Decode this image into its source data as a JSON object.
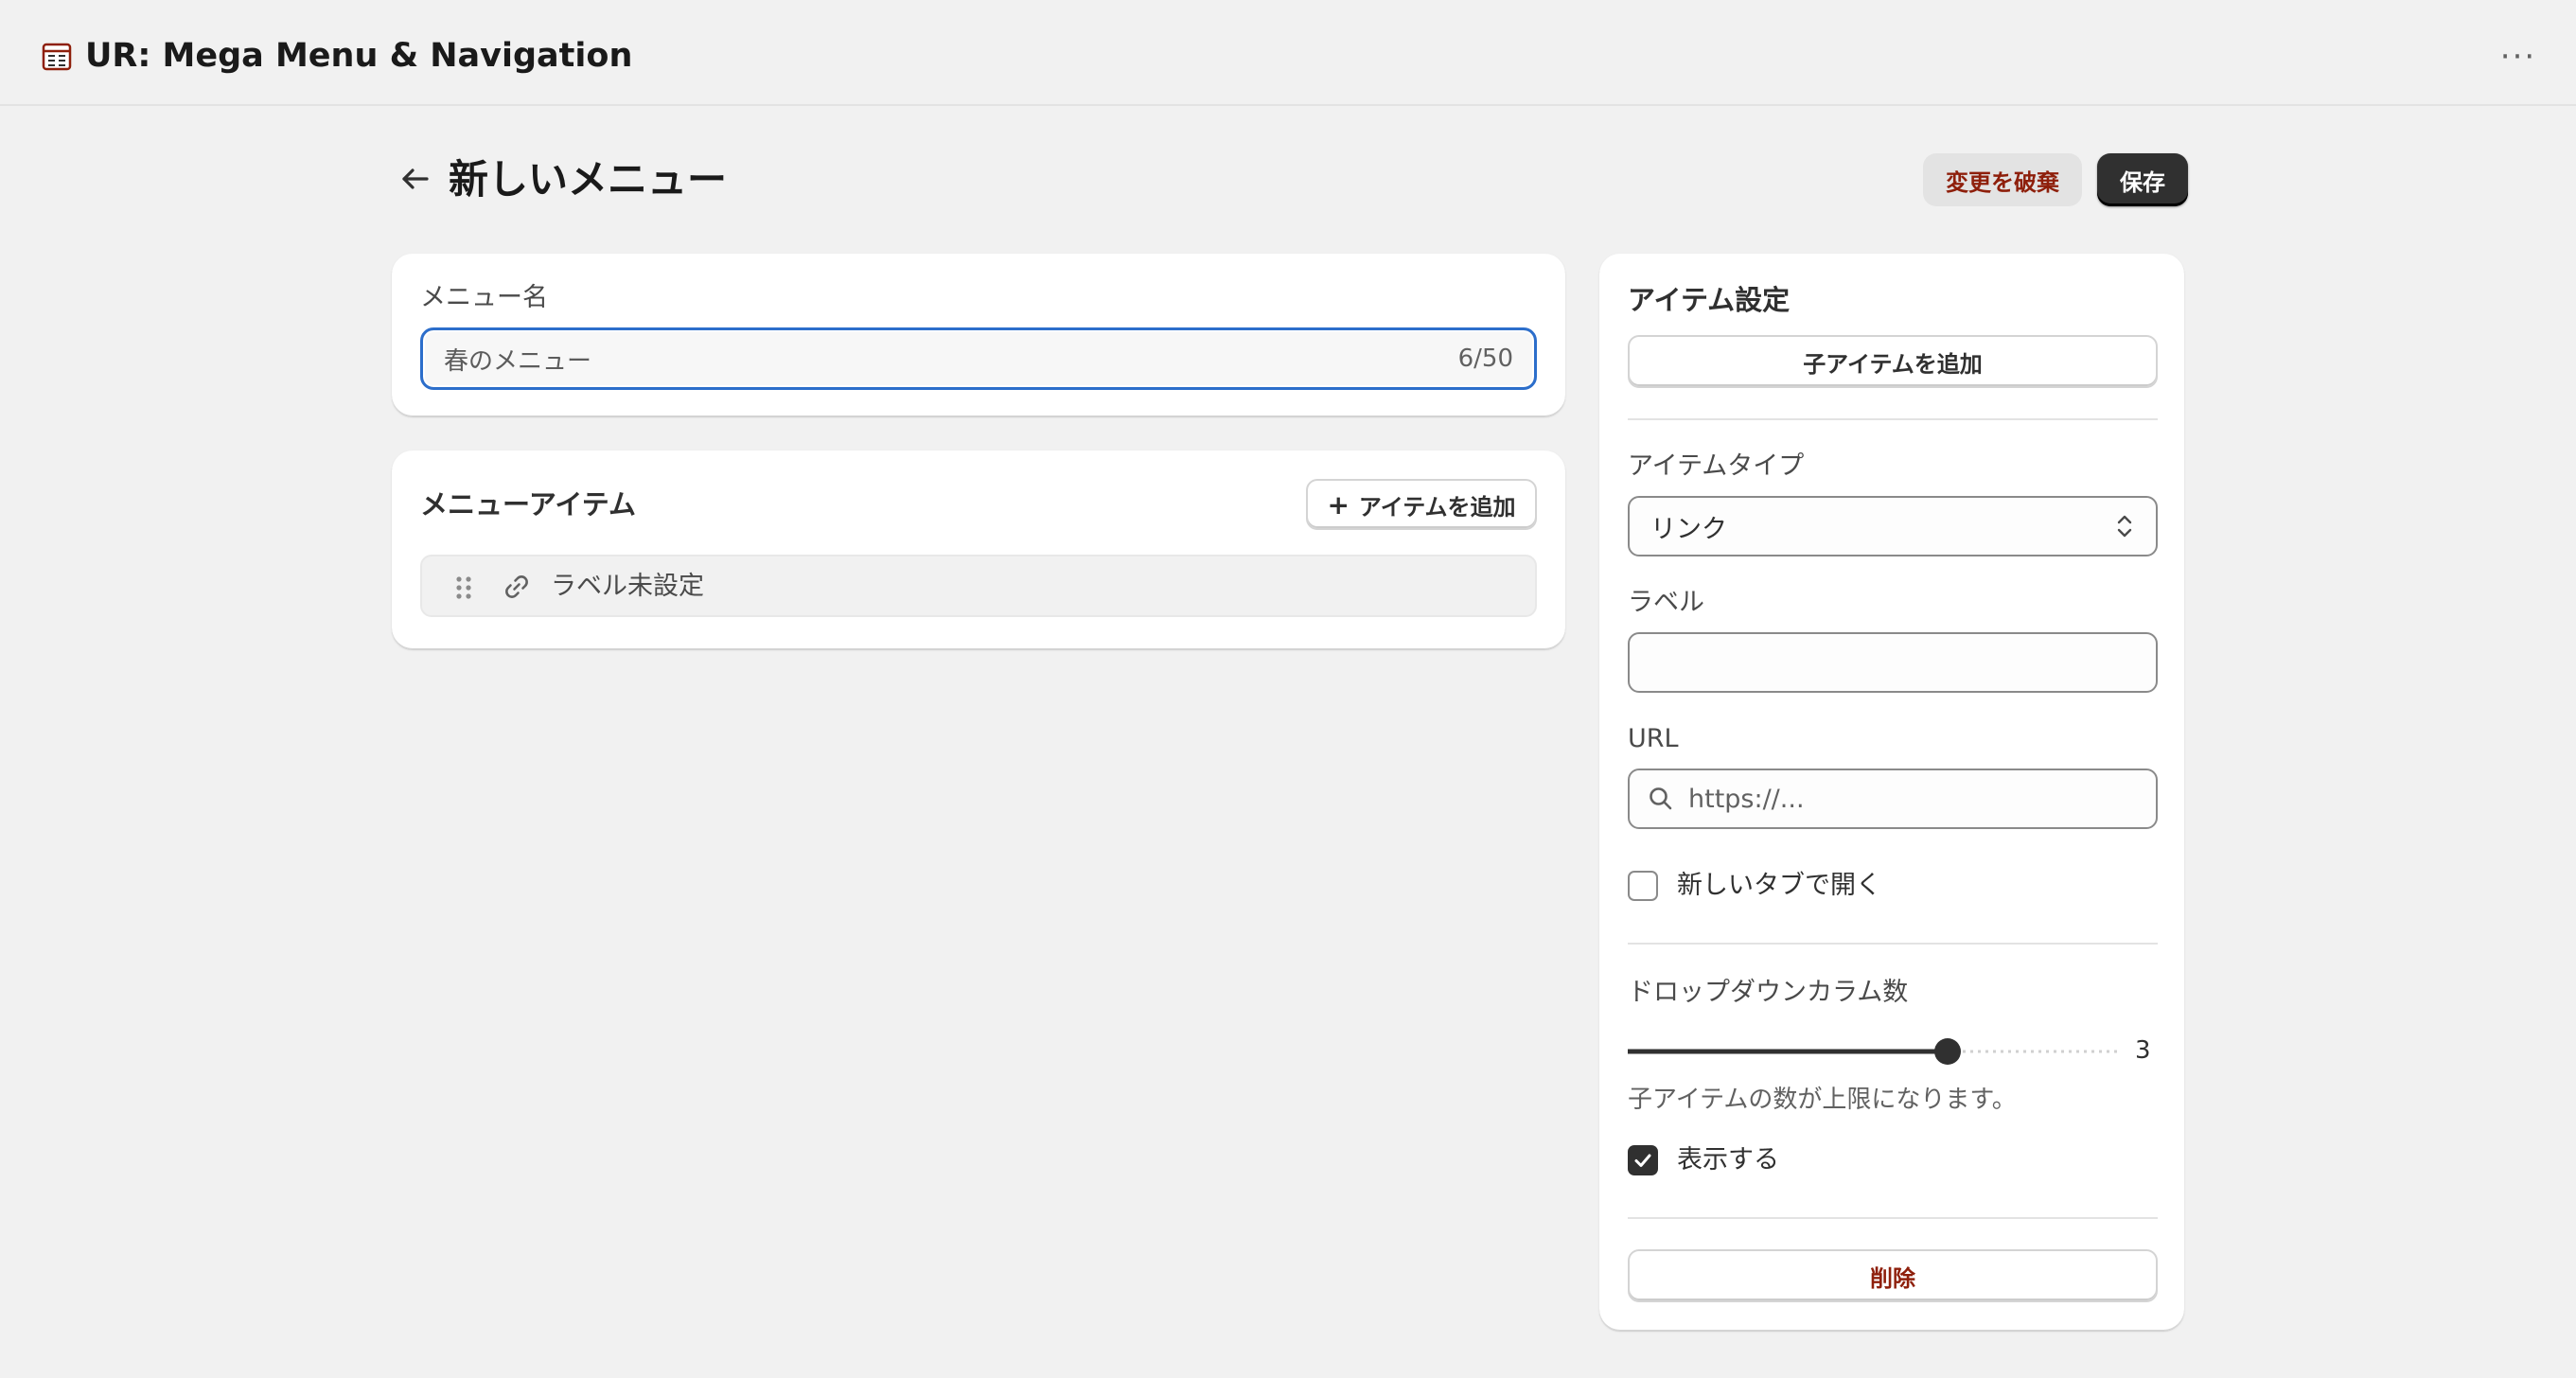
{
  "app": {
    "title": "UR: Mega Menu & Navigation",
    "app_icon": "table-icon",
    "more_icon": "ellipsis-icon",
    "more_label": "···"
  },
  "page": {
    "title": "新しいメニュー",
    "back_icon": "arrow-left-icon",
    "discard_label": "変更を破棄",
    "save_label": "保存"
  },
  "menu_name": {
    "label": "メニュー名",
    "value": "春のメニュー",
    "char_count": "6/50"
  },
  "menu_items": {
    "title": "メニューアイテム",
    "add_button_label": "アイテムを追加",
    "add_button_icon": "+",
    "items": [
      {
        "label": "ラベル未設定",
        "drag_icon": "drag-handle-icon",
        "type_icon": "link-icon"
      }
    ]
  },
  "item_settings": {
    "title": "アイテム設定",
    "add_child_label": "子アイテムを追加",
    "item_type_label": "アイテムタイプ",
    "item_type_value": "リンク",
    "label_field_label": "ラベル",
    "label_field_value": "",
    "url_label": "URL",
    "url_placeholder": "https://...",
    "open_new_tab_label": "新しいタブで開く",
    "open_new_tab_checked": false,
    "dropdown_columns_label": "ドロップダウンカラム数",
    "dropdown_columns_value": "3",
    "dropdown_columns_fraction": 0.65,
    "help_text": "子アイテムの数が上限になります。",
    "show_label": "表示する",
    "show_checked": true,
    "delete_label": "削除"
  },
  "colors": {
    "background": "#f1f1f1",
    "card": "#ffffff",
    "primary_button": "#303030",
    "critical_text": "#8e1f0b",
    "focus_ring": "#2c6ecb"
  }
}
